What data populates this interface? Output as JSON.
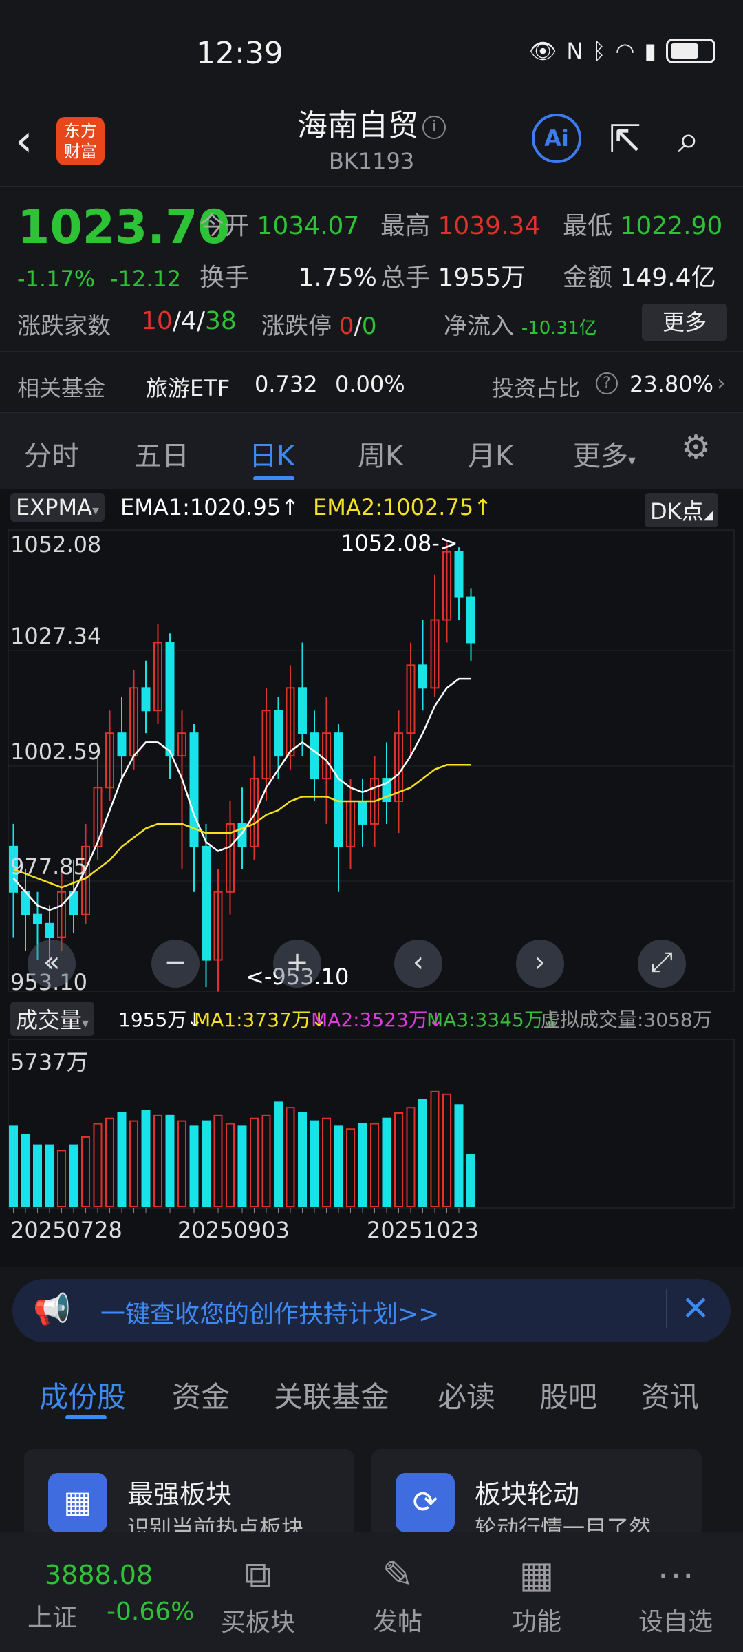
{
  "status": {
    "time": "12:39",
    "icons": [
      "eye-icon",
      "nfc-icon",
      "bluetooth-icon",
      "wifi-icon",
      "5g-signal-icon",
      "battery-icon"
    ]
  },
  "header": {
    "logo_line1": "东方",
    "logo_line2": "财富",
    "title": "海南自贸",
    "code": "BK1193",
    "ai_label": "Ai"
  },
  "quote": {
    "price": "1023.70",
    "change_pct": "-1.17%",
    "change": "-12.12",
    "open_label": "今开",
    "open": "1034.07",
    "high_label": "最高",
    "high": "1039.34",
    "low_label": "最低",
    "low": "1022.90",
    "turnover_label": "换手",
    "turnover": "1.75%",
    "volume_label": "总手",
    "volume": "1955万",
    "amount_label": "金额",
    "amount": "149.4亿",
    "updown_label": "涨跌家数",
    "up": "10",
    "sep": "/",
    "flat": "4",
    "down": "38",
    "limit_label": "涨跌停",
    "limit_up": "0",
    "limit_down": "0",
    "netflow_label": "净流入",
    "netflow": "-10.31亿",
    "more": "更多"
  },
  "fund": {
    "label": "相关基金",
    "name": "旅游ETF",
    "price": "0.732",
    "pct": "0.00%",
    "ratio_label": "投资占比",
    "ratio": "23.80%"
  },
  "period_tabs": [
    "分时",
    "五日",
    "日K",
    "周K",
    "月K",
    "更多"
  ],
  "chart_header": {
    "indicator": "EXPMA",
    "ema1": "EMA1:1020.95↑",
    "ema2": "EMA2:1002.75↑",
    "dk": "DK点"
  },
  "price_axis": [
    "1052.08",
    "1027.34",
    "1002.59",
    "977.85",
    "953.10"
  ],
  "annot": {
    "high": "1052.08->",
    "low": "<-953.10"
  },
  "vol_header": {
    "label": "成交量",
    "vol": "1955万↓",
    "ma1": "MA1:3737万↓",
    "ma2": "MA2:3523万↓",
    "ma3": "MA3:3345万↓",
    "virtual": "虚拟成交量:3058万"
  },
  "vol_axis": "5737万",
  "date_labels": [
    "20250728",
    "20250903",
    "20251023"
  ],
  "banner": {
    "text": "一键查收您的创作扶持计划>>"
  },
  "sub_tabs": [
    "成份股",
    "资金",
    "关联基金",
    "必读",
    "股吧",
    "资讯"
  ],
  "cards": [
    {
      "title": "最强板块",
      "desc": "识别当前热点板块"
    },
    {
      "title": "板块轮动",
      "desc": "轮动行情一目了然"
    }
  ],
  "bottom": {
    "index_price": "3888.08",
    "index_name": "上证",
    "index_pct": "-0.66%",
    "nav": [
      "买板块",
      "发帖",
      "功能",
      "设自选"
    ]
  },
  "colors": {
    "up": "#e0312a",
    "down": "#2ec236",
    "accent": "#3d8af7",
    "cyan": "#19e3e8",
    "ema1": "#ffffff",
    "ema2": "#f5e11c"
  },
  "chart_data": {
    "type": "candlestick",
    "ylim": [
      953.1,
      1052.08
    ],
    "x_labels": [
      "20250728",
      "20250903",
      "20251023"
    ],
    "candles": [
      [
        985,
        975,
        990,
        965
      ],
      [
        975,
        970,
        980,
        962
      ],
      [
        970,
        968,
        975,
        960
      ],
      [
        968,
        965,
        972,
        958
      ],
      [
        965,
        975,
        980,
        962
      ],
      [
        975,
        970,
        982,
        966
      ],
      [
        970,
        985,
        990,
        968
      ],
      [
        985,
        998,
        1005,
        982
      ],
      [
        998,
        1010,
        1015,
        995
      ],
      [
        1010,
        1005,
        1018,
        1000
      ],
      [
        1005,
        1020,
        1024,
        1002
      ],
      [
        1020,
        1015,
        1026,
        1010
      ],
      [
        1015,
        1030,
        1034,
        1012
      ],
      [
        1030,
        1005,
        1032,
        1000
      ],
      [
        1005,
        1010,
        1015,
        980
      ],
      [
        1010,
        985,
        1012,
        975
      ],
      [
        985,
        960,
        990,
        954
      ],
      [
        960,
        975,
        980,
        953
      ],
      [
        975,
        990,
        995,
        970
      ],
      [
        990,
        985,
        998,
        980
      ],
      [
        985,
        1000,
        1005,
        982
      ],
      [
        1000,
        1015,
        1020,
        995
      ],
      [
        1015,
        1005,
        1018,
        1000
      ],
      [
        1005,
        1020,
        1025,
        1002
      ],
      [
        1020,
        1010,
        1030,
        1005
      ],
      [
        1010,
        1000,
        1015,
        995
      ],
      [
        1000,
        1010,
        1018,
        990
      ],
      [
        1010,
        985,
        1012,
        975
      ],
      [
        985,
        995,
        1000,
        980
      ],
      [
        995,
        990,
        1000,
        985
      ],
      [
        990,
        1000,
        1005,
        985
      ],
      [
        1000,
        995,
        1008,
        990
      ],
      [
        995,
        1010,
        1015,
        988
      ],
      [
        1010,
        1025,
        1030,
        1005
      ],
      [
        1025,
        1020,
        1035,
        1015
      ],
      [
        1020,
        1035,
        1045,
        1018
      ],
      [
        1035,
        1050,
        1052,
        1030
      ],
      [
        1050,
        1040,
        1051,
        1035
      ],
      [
        1040,
        1030,
        1042,
        1026
      ]
    ],
    "volumes": [
      3000,
      2700,
      2300,
      2300,
      2100,
      2300,
      2600,
      3100,
      3300,
      3500,
      3200,
      3600,
      3400,
      3400,
      3200,
      3000,
      3200,
      3400,
      3100,
      3000,
      3300,
      3400,
      3900,
      3700,
      3500,
      3200,
      3300,
      3000,
      2900,
      3100,
      3100,
      3300,
      3500,
      3700,
      4000,
      4300,
      4200,
      3800,
      1955
    ],
    "ema1": [
      978,
      975,
      972,
      971,
      972,
      975,
      980,
      986,
      993,
      1000,
      1005,
      1008,
      1008,
      1006,
      1000,
      992,
      986,
      984,
      985,
      988,
      992,
      998,
      1002,
      1006,
      1008,
      1006,
      1004,
      1000,
      998,
      997,
      998,
      999,
      1001,
      1005,
      1010,
      1016,
      1020,
      1022,
      1022
    ],
    "ema2": [
      980,
      979,
      978,
      977,
      976,
      977,
      978,
      980,
      982,
      985,
      987,
      989,
      990,
      990,
      990,
      989,
      988,
      988,
      988,
      989,
      990,
      992,
      993,
      995,
      996,
      996,
      996,
      995,
      995,
      995,
      995,
      996,
      997,
      998,
      1000,
      1002,
      1003,
      1003,
      1003
    ]
  }
}
